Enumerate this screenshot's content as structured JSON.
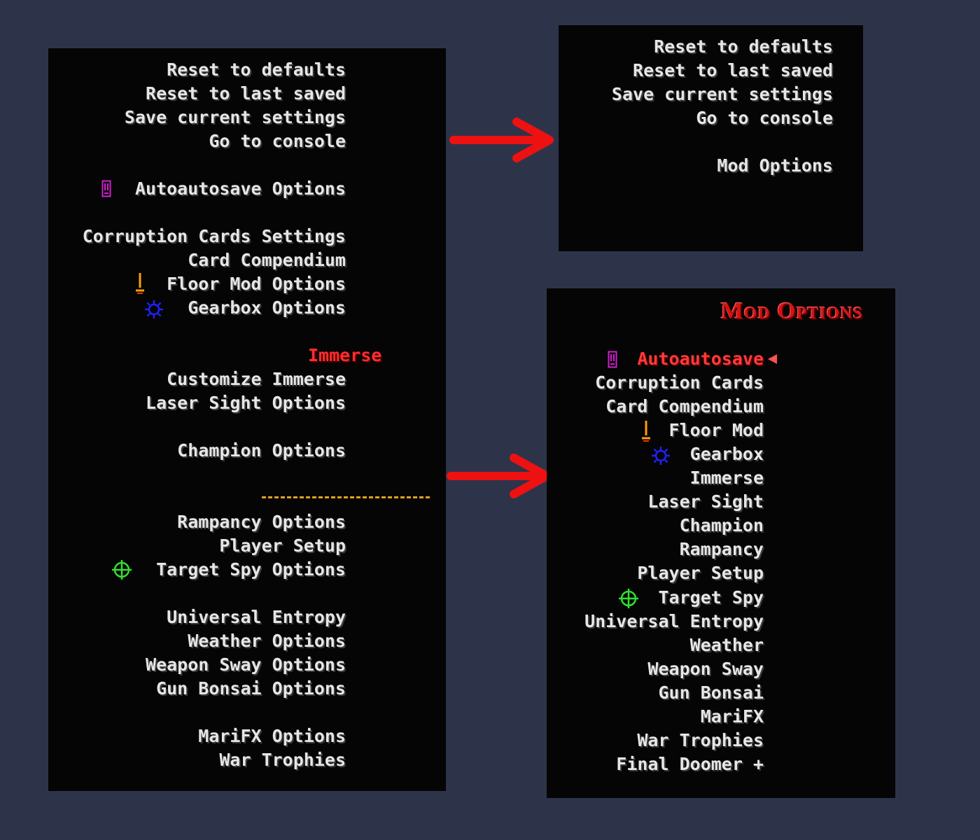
{
  "left_menu": {
    "reset_defaults": "Reset to defaults",
    "reset_last_saved": "Reset to last saved",
    "save_current": "Save current settings",
    "go_console": "Go to console",
    "autoautosave": "Autoautosave Options",
    "corruption_cards": "Corruption Cards Settings",
    "card_compendium": "Card Compendium",
    "floor_mod": "Floor Mod Options",
    "gearbox": "Gearbox Options",
    "immerse_header": "Immerse",
    "customize_immerse": "Customize Immerse",
    "laser_sight": "Laser Sight Options",
    "champion": "Champion Options",
    "rampancy": "Rampancy Options",
    "player_setup": "Player Setup",
    "target_spy": "Target Spy Options",
    "universal_entropy": "Universal Entropy",
    "weather": "Weather Options",
    "weapon_sway": "Weapon Sway Options",
    "gun_bonsai": "Gun Bonsai Options",
    "marifx": "MariFX Options",
    "war_trophies": "War Trophies"
  },
  "top_right_menu": {
    "reset_defaults": "Reset to defaults",
    "reset_last_saved": "Reset to last saved",
    "save_current": "Save current settings",
    "go_console": "Go to console",
    "mod_options": "Mod Options"
  },
  "mod_options_menu": {
    "title": "Mod Options",
    "items": [
      "Autoautosave",
      "Corruption Cards",
      "Card Compendium",
      "Floor Mod",
      "Gearbox",
      "Immerse",
      "Laser Sight",
      "Champion",
      "Rampancy",
      "Player Setup",
      "Target Spy",
      "Universal Entropy",
      "Weather",
      "Weapon Sway",
      "Gun Bonsai",
      "MariFX",
      "War Trophies",
      "Final Doomer +"
    ],
    "selected_index": 0
  },
  "colors": {
    "background": "#2d344a",
    "panel": "#050505",
    "menu_text": "#e6e6e6",
    "selected_text": "#ff3a3a",
    "arrow": "#ee1111",
    "divider": "#e0a020",
    "autoautosave_icon": "#d020d0",
    "floor_icon": "#ffa000",
    "gearbox_icon": "#2020ff",
    "target_icon": "#30e030"
  },
  "icons": {
    "autoautosave": "magenta-save-slot-icon",
    "floor_mod": "orange-floor-marker-icon",
    "gearbox": "blue-gear-icon",
    "target_spy": "green-crosshair-icon",
    "selection_cursor": "left-pointer-icon",
    "transition_arrows": "red-right-arrow-icon"
  }
}
